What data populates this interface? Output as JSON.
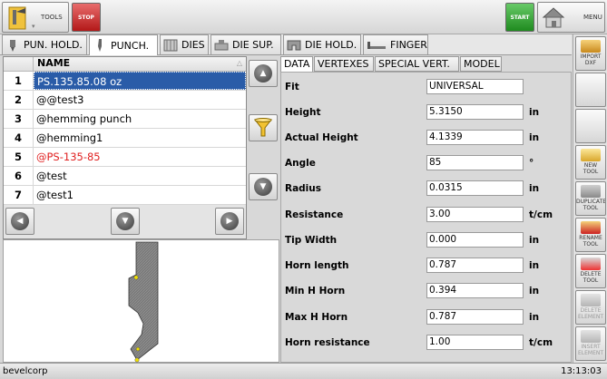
{
  "toolbar": {
    "tools_label": "TOOLS",
    "stop_label": "STOP",
    "start_label": "START",
    "menu_label": "MENU"
  },
  "tabs": [
    {
      "label": "PUN. HOLD."
    },
    {
      "label": "PUNCH."
    },
    {
      "label": "DIES"
    },
    {
      "label": "DIE SUP."
    },
    {
      "label": "DIE HOLD."
    },
    {
      "label": "FINGER"
    }
  ],
  "list": {
    "header": "NAME",
    "rows": [
      {
        "num": "1",
        "name": "PS.135.85.08 oz"
      },
      {
        "num": "2",
        "name": "@@test3"
      },
      {
        "num": "3",
        "name": "@hemming punch"
      },
      {
        "num": "4",
        "name": "@hemming1"
      },
      {
        "num": "5",
        "name": "@PS-135-85"
      },
      {
        "num": "6",
        "name": "@test"
      },
      {
        "num": "7",
        "name": "@test1"
      }
    ]
  },
  "data_tabs": [
    {
      "label": "DATA"
    },
    {
      "label": "VERTEXES"
    },
    {
      "label": "SPECIAL VERT."
    },
    {
      "label": "MODEL"
    }
  ],
  "fields": [
    {
      "label": "Fit",
      "value": "UNIVERSAL",
      "unit": ""
    },
    {
      "label": "Height",
      "value": "5.3150",
      "unit": "in"
    },
    {
      "label": "Actual Height",
      "value": "4.1339",
      "unit": "in"
    },
    {
      "label": "Angle",
      "value": "85",
      "unit": "°"
    },
    {
      "label": "Radius",
      "value": "0.0315",
      "unit": "in"
    },
    {
      "label": "Resistance",
      "value": "3.00",
      "unit": "t/cm"
    },
    {
      "label": "Tip Width",
      "value": "0.000",
      "unit": "in"
    },
    {
      "label": "Horn length",
      "value": "0.787",
      "unit": "in"
    },
    {
      "label": "Min H Horn",
      "value": "0.394",
      "unit": "in"
    },
    {
      "label": "Max H Horn",
      "value": "0.787",
      "unit": "in"
    },
    {
      "label": "Horn resistance",
      "value": "1.00",
      "unit": "t/cm"
    }
  ],
  "sidebar": {
    "import_dxf": [
      "IMPORT",
      "DXF"
    ],
    "new_tool": [
      "NEW",
      "TOOL"
    ],
    "duplicate_tool": [
      "DUPLICATE",
      "TOOL"
    ],
    "rename_tool": [
      "RENAME",
      "TOOL"
    ],
    "delete_tool": [
      "DELETE",
      "TOOL"
    ],
    "delete_element": [
      "DELETE",
      "ELEMENT"
    ],
    "insert_element": [
      "INSERT",
      "ELEMENT"
    ]
  },
  "status": {
    "user": "bevelcorp",
    "time": "13:13:03"
  },
  "colors": {
    "selection": "#2a5ca8",
    "highlight_text": "#e02020",
    "stop": "#b31818",
    "start": "#1f8b1f"
  }
}
